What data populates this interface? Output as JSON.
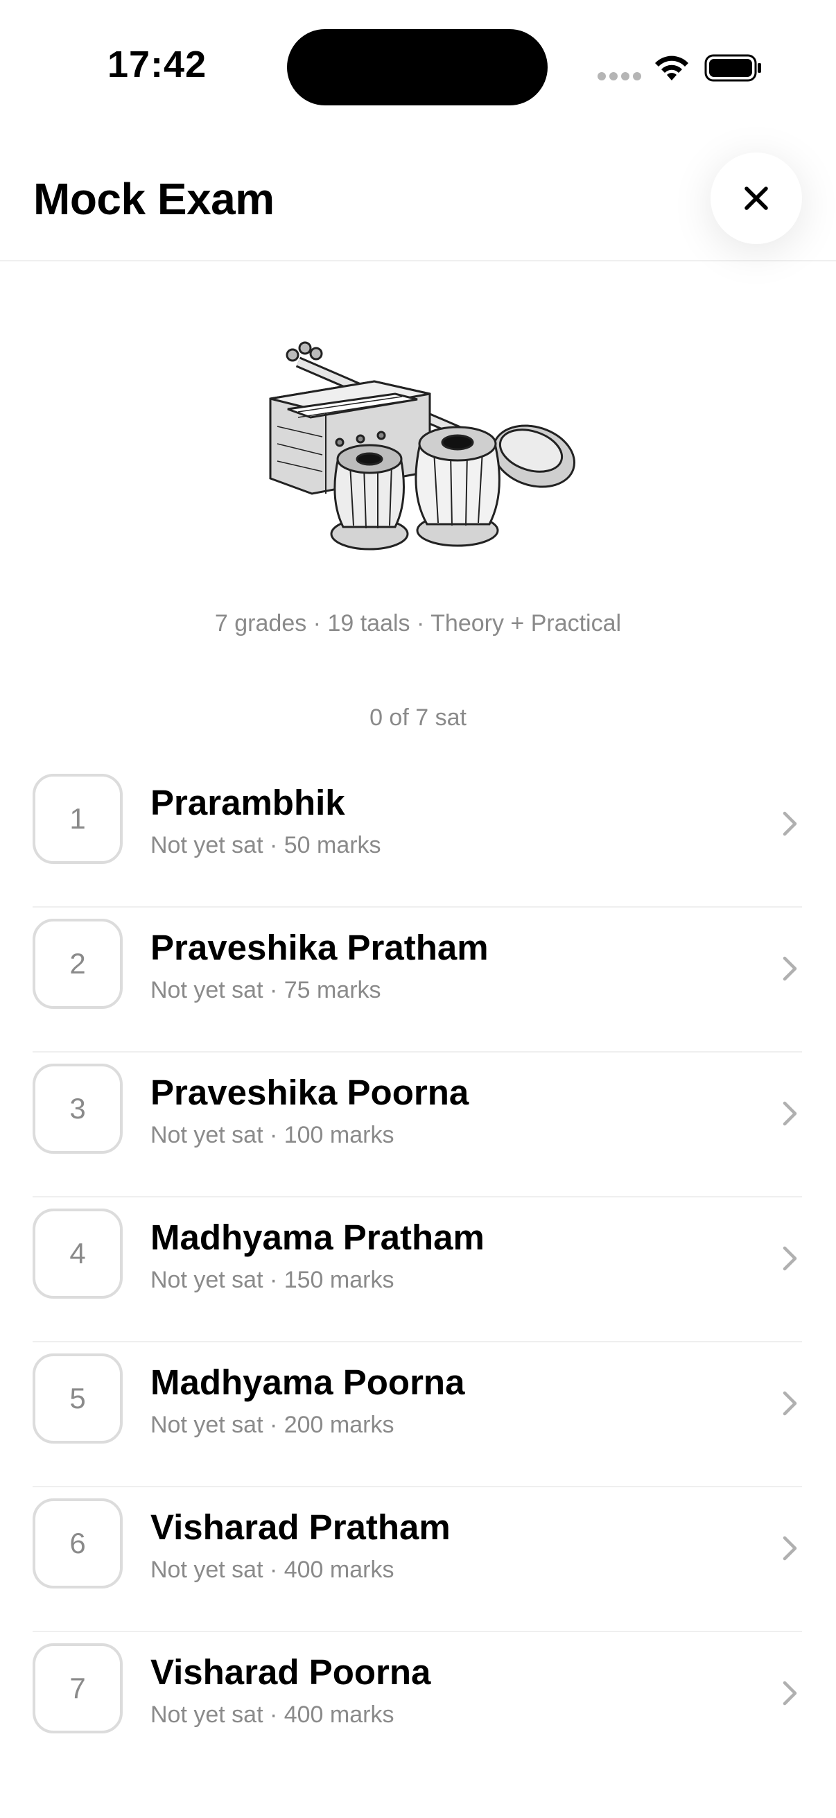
{
  "status_bar": {
    "time": "17:42"
  },
  "header": {
    "title": "Mock Exam",
    "close_icon": "close-icon"
  },
  "hero": {
    "illustration": "indian-instruments-illustration"
  },
  "summary": "7 grades · 19 taals · Theory + Practical",
  "progress": "0 of 7 sat",
  "grades": [
    {
      "number": "1",
      "title": "Prarambhik",
      "subtitle": "Not yet sat · 50 marks"
    },
    {
      "number": "2",
      "title": "Praveshika Pratham",
      "subtitle": "Not yet sat · 75 marks"
    },
    {
      "number": "3",
      "title": "Praveshika Poorna",
      "subtitle": "Not yet sat · 100 marks"
    },
    {
      "number": "4",
      "title": "Madhyama Pratham",
      "subtitle": "Not yet sat · 150 marks"
    },
    {
      "number": "5",
      "title": "Madhyama Poorna",
      "subtitle": "Not yet sat · 200 marks"
    },
    {
      "number": "6",
      "title": "Visharad Pratham",
      "subtitle": "Not yet sat · 400 marks"
    },
    {
      "number": "7",
      "title": "Visharad Poorna",
      "subtitle": "Not yet sat · 400 marks"
    }
  ]
}
